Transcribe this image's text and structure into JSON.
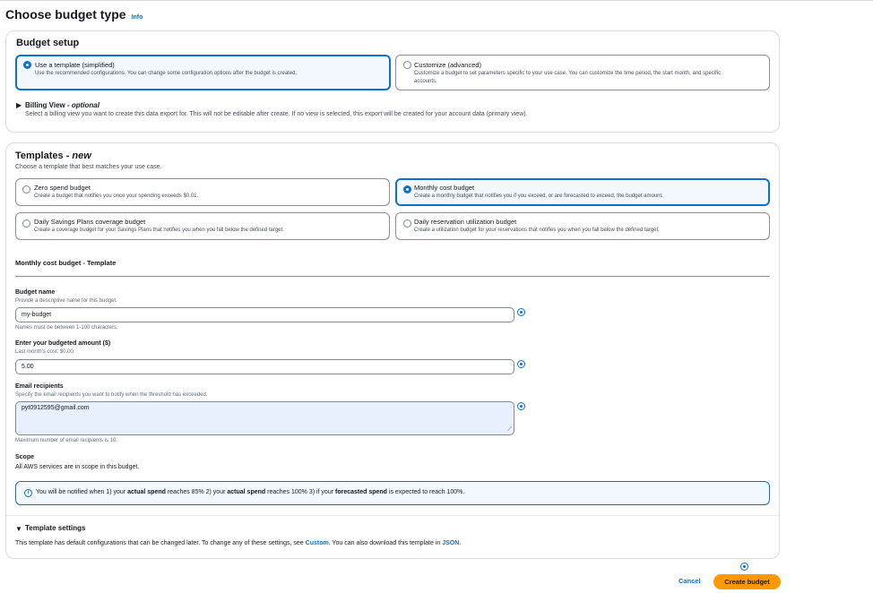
{
  "page": {
    "title": "Choose budget type",
    "info_label": "Info"
  },
  "budget_setup": {
    "heading": "Budget setup",
    "options": [
      {
        "label": "Use a template (simplified)",
        "description": "Use the recommended configurations. You can change some configuration options after the budget is created.",
        "selected": true
      },
      {
        "label": "Customize (advanced)",
        "description_line1": "Customize a budget to set parameters specific to your use case. You can customize the time period, the start month, and specific",
        "description_line2": "accounts.",
        "selected": false
      }
    ],
    "billing_view": {
      "title": "Billing View",
      "optional": "optional",
      "description": "Select a billing view you want to create this data export for. This will not be editable after create. If no view is selected, this export will be created for your account data (primary view)."
    }
  },
  "templates": {
    "heading": "Templates",
    "heading_badge": "new",
    "description": "Choose a template that best matches your use case.",
    "options": [
      {
        "label": "Zero spend budget",
        "description": "Create a budget that notifies you once your spending exceeds $0.01.",
        "selected": false
      },
      {
        "label": "Monthly cost budget",
        "description": "Create a monthly budget that notifies you if you exceed, or are forecasted to exceed, the budget amount.",
        "selected": true
      },
      {
        "label": "Daily Savings Plans coverage budget",
        "description": "Create a coverage budget for your Savings Plans that notifies you when you fall below the defined target.",
        "selected": false
      },
      {
        "label": "Daily reservation utilization budget",
        "description": "Create a utilization budget for your reservations that notifies you when you fall below the defined target.",
        "selected": false
      }
    ],
    "section_title": "Monthly cost budget - Template"
  },
  "form": {
    "budget_name": {
      "label": "Budget name",
      "description": "Provide a descriptive name for this budget.",
      "value": "my-budget",
      "hint": "Names must be between 1-100 characters."
    },
    "amount": {
      "label": "Enter your budgeted amount ($)",
      "description": "Last month's cost: $0.00",
      "value": "5.00"
    },
    "email": {
      "label": "Email recipients",
      "description": "Specify the email recipients you want to notify when the threshold has exceeded.",
      "value": "pyt0912595@gmail.com",
      "hint": "Maximum number of email recipients is 10."
    },
    "scope": {
      "label": "Scope",
      "text": "All AWS services are in scope in this budget."
    }
  },
  "alert": {
    "part1": "You will be notified when 1) your ",
    "bold1": "actual spend",
    "part2": " reaches 85% 2) your ",
    "bold2": "actual spend",
    "part3": " reaches 100% 3) if your ",
    "bold3": "forecasted spend",
    "part4": " is expected to reach 100%."
  },
  "template_settings": {
    "title": "Template settings",
    "text1": "This template has default configurations that can be changed later. To change any of these settings, see ",
    "link1": "Custom",
    "text2": ". You can also download this template in ",
    "link2": "JSON",
    "text3": "."
  },
  "actions": {
    "cancel": "Cancel",
    "create": "Create budget"
  },
  "colors": {
    "accent": "#0972d3",
    "primary_button": "#ff9900"
  }
}
